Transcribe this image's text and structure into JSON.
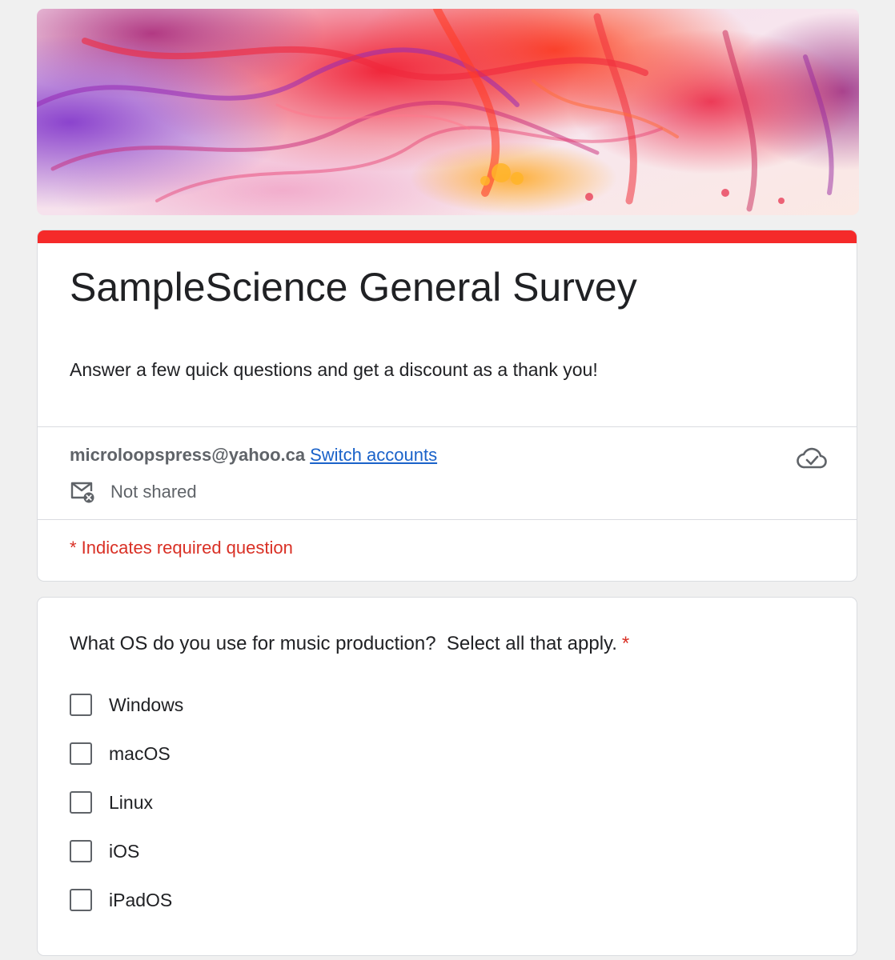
{
  "form": {
    "title": "SampleScience General Survey",
    "description": "Answer a few quick questions and get a discount as a thank you!",
    "accent_color": "#f52a2a"
  },
  "account": {
    "email": "microloopspress@yahoo.ca",
    "switch_label": "Switch accounts",
    "shared_status": "Not shared",
    "save_status_icon": "cloud-done-icon"
  },
  "required_note": "* Indicates required question",
  "question": {
    "text": "What OS do you use for music production?  Select all that apply.",
    "required_marker": "*",
    "options": [
      {
        "label": "Windows",
        "checked": false
      },
      {
        "label": "macOS",
        "checked": false
      },
      {
        "label": "Linux",
        "checked": false
      },
      {
        "label": "iOS",
        "checked": false
      },
      {
        "label": "iPadOS",
        "checked": false
      }
    ]
  }
}
